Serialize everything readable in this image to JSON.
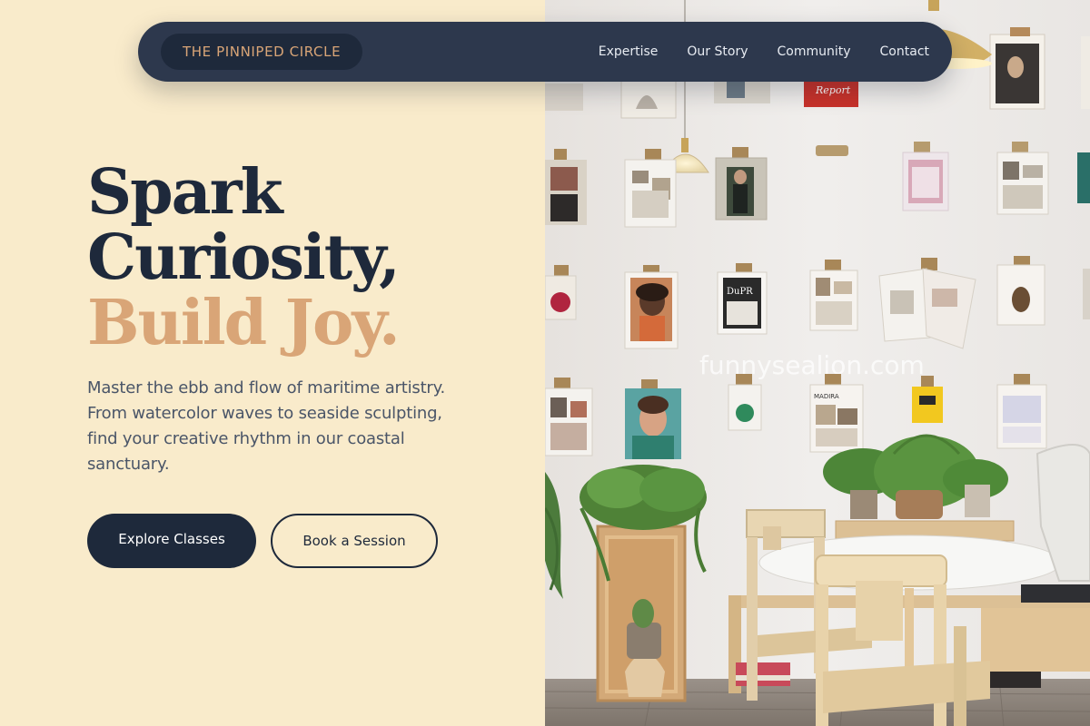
{
  "brand": {
    "name": "THE PINNIPED CIRCLE"
  },
  "nav": {
    "items": [
      {
        "label": "Expertise"
      },
      {
        "label": "Our Story"
      },
      {
        "label": "Community"
      },
      {
        "label": "Contact"
      }
    ]
  },
  "hero": {
    "headline_line1": "Spark",
    "headline_line2": "Curiosity,",
    "headline_line3": "Build Joy.",
    "description": "Master the ebb and flow of maritime artistry. From watercolor waves to seaside sculpting, find your creative rhythm in our coastal sanctuary.",
    "primary_cta": "Explore Classes",
    "secondary_cta": "Book a Session"
  },
  "photo": {
    "watermark": "funnysealion.com",
    "poster_labels": [
      "Report",
      "DuPR",
      "MADIRA"
    ]
  },
  "colors": {
    "background": "#f9ebcb",
    "navy": "#1e293b",
    "accent": "#d9a577",
    "body_text": "#4a5568"
  }
}
